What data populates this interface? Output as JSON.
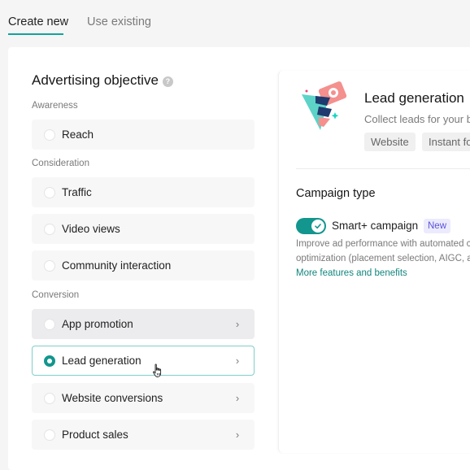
{
  "tabs": [
    {
      "label": "Create new",
      "active": true
    },
    {
      "label": "Use existing",
      "active": false
    }
  ],
  "objective": {
    "title": "Advertising objective",
    "help_icon": "question-circle-icon",
    "sections": [
      {
        "label": "Awareness",
        "options": [
          {
            "label": "Reach",
            "state": "default",
            "has_chevron": false
          }
        ]
      },
      {
        "label": "Consideration",
        "options": [
          {
            "label": "Traffic",
            "state": "default",
            "has_chevron": false
          },
          {
            "label": "Video views",
            "state": "default",
            "has_chevron": false
          },
          {
            "label": "Community interaction",
            "state": "default",
            "has_chevron": false
          }
        ]
      },
      {
        "label": "Conversion",
        "options": [
          {
            "label": "App promotion",
            "state": "hover",
            "has_chevron": true
          },
          {
            "label": "Lead generation",
            "state": "selected",
            "has_chevron": true
          },
          {
            "label": "Website conversions",
            "state": "default",
            "has_chevron": true
          },
          {
            "label": "Product sales",
            "state": "default",
            "has_chevron": true
          }
        ]
      }
    ]
  },
  "detail": {
    "icon": "lead-generation-illustration-icon",
    "title": "Lead generation",
    "description": "Collect leads for your b",
    "tags": [
      "Website",
      "Instant fo"
    ],
    "campaign_type": {
      "title": "Campaign type",
      "toggle_on": true,
      "label": "Smart+ campaign",
      "badge": "New",
      "description_lines": [
        "Improve ad performance with automated ca",
        "optimization (placement selection, AIGC, a"
      ],
      "link": "More features and benefits"
    }
  },
  "colors": {
    "accent": "#12968e",
    "tab_underline": "#12a39a",
    "badge_bg": "#ecebfd",
    "badge_text": "#5b53d6"
  }
}
